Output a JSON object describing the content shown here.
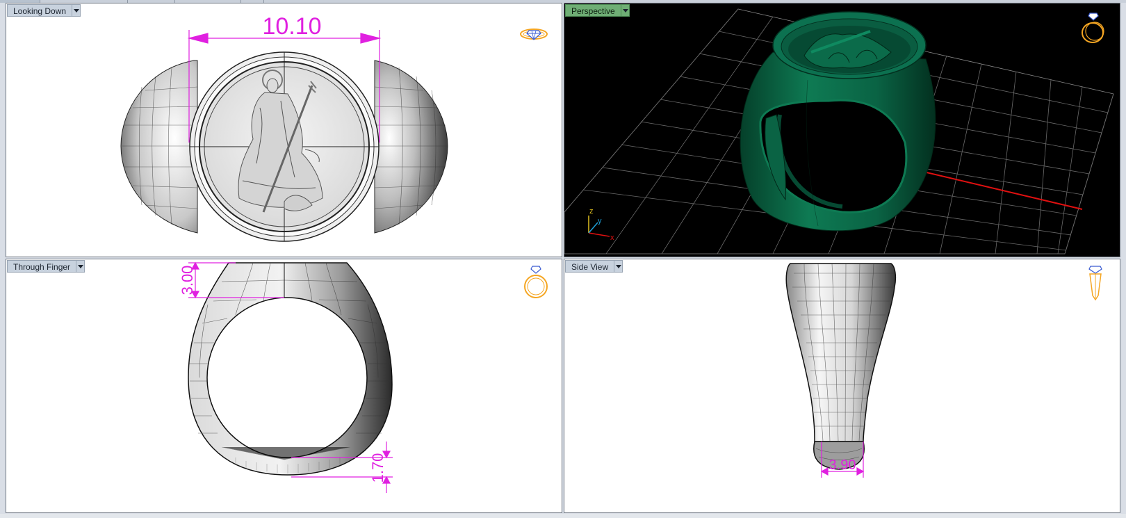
{
  "viewports": {
    "top_left": {
      "title": "Looking Down",
      "dimension": "10.10"
    },
    "top_right": {
      "title": "Perspective",
      "axis_labels": {
        "z": "z",
        "y": "y",
        "x": "x"
      }
    },
    "bottom_left": {
      "title": "Through Finger",
      "dimension_top": "3.00",
      "dimension_bottom": "1.70"
    },
    "bottom_right": {
      "title": "Side View",
      "dimension": "3.90"
    }
  },
  "colors": {
    "dimension": "#e020e0",
    "active_tab": "#6fae75",
    "ring_green": "#0b6b4a",
    "view_icon": "#f5a623"
  },
  "icons": {
    "top_left": "gem-top-view-icon",
    "top_right": "ring-perspective-icon",
    "bottom_left": "ring-front-icon",
    "bottom_right": "ring-side-icon"
  }
}
